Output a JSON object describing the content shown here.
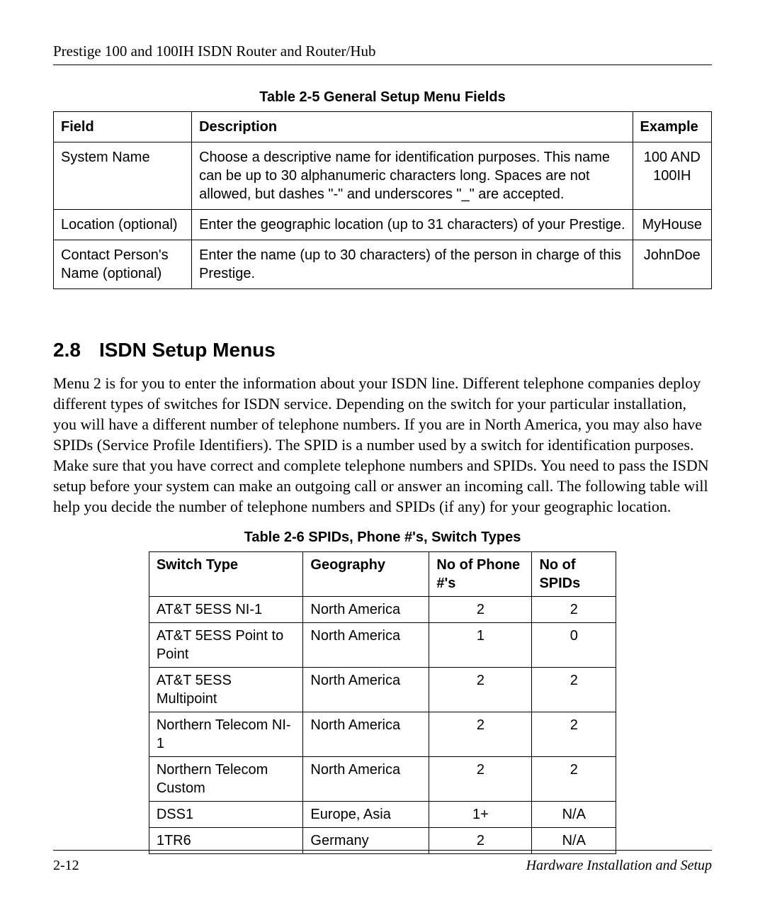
{
  "header": {
    "running_title": "Prestige 100 and 100IH ISDN Router and Router/Hub"
  },
  "table25": {
    "caption": "Table 2-5 General Setup Menu Fields",
    "headers": {
      "field": "Field",
      "description": "Description",
      "example": "Example"
    },
    "rows": [
      {
        "field": "System Name",
        "description": "Choose a descriptive name for identification purposes. This name can be up to 30 alphanumeric characters long. Spaces are not allowed, but dashes \"-\" and underscores \"_\" are accepted.",
        "example": "100 AND 100IH"
      },
      {
        "field": "Location (optional)",
        "description": "Enter the geographic location (up to 31 characters) of your Prestige.",
        "example": "MyHouse"
      },
      {
        "field": "Contact Person's Name (optional)",
        "description": "Enter the name (up to 30 characters) of the person in charge of this Prestige.",
        "example": "JohnDoe"
      }
    ]
  },
  "section": {
    "number": "2.8",
    "title": "ISDN Setup Menus",
    "paragraph": "Menu 2 is for you to enter the information about your ISDN line. Different telephone companies deploy different types of switches for ISDN service. Depending on the switch for your particular installation, you will have a different number of telephone numbers. If you are in North America, you may also have SPIDs (Service Profile Identifiers). The SPID is a number used by a switch for identification purposes. Make sure that you have correct and complete telephone numbers and SPIDs. You need to pass the ISDN setup before your system can make an outgoing call or answer an incoming call. The following table will help you decide the number of telephone numbers and SPIDs (if any) for your geographic location."
  },
  "table26": {
    "caption": "Table 2-6 SPIDs, Phone #'s, Switch Types",
    "headers": {
      "switch": "Switch Type",
      "geo": "Geography",
      "phones": "No of Phone #'s",
      "spids": "No of SPIDs"
    },
    "rows": [
      {
        "switch": "AT&T 5ESS NI-1",
        "geo": "North America",
        "phones": "2",
        "spids": "2"
      },
      {
        "switch": "AT&T 5ESS Point to Point",
        "geo": "North America",
        "phones": "1",
        "spids": "0"
      },
      {
        "switch": "AT&T 5ESS Multipoint",
        "geo": "North America",
        "phones": "2",
        "spids": "2"
      },
      {
        "switch": "Northern Telecom NI-1",
        "geo": "North America",
        "phones": "2",
        "spids": "2"
      },
      {
        "switch": "Northern Telecom Custom",
        "geo": "North America",
        "phones": "2",
        "spids": "2"
      },
      {
        "switch": "DSS1",
        "geo": "Europe, Asia",
        "phones": "1+",
        "spids": "N/A"
      },
      {
        "switch": "1TR6",
        "geo": "Germany",
        "phones": "2",
        "spids": "N/A"
      }
    ]
  },
  "footer": {
    "page": "2-12",
    "section": "Hardware Installation and Setup"
  }
}
